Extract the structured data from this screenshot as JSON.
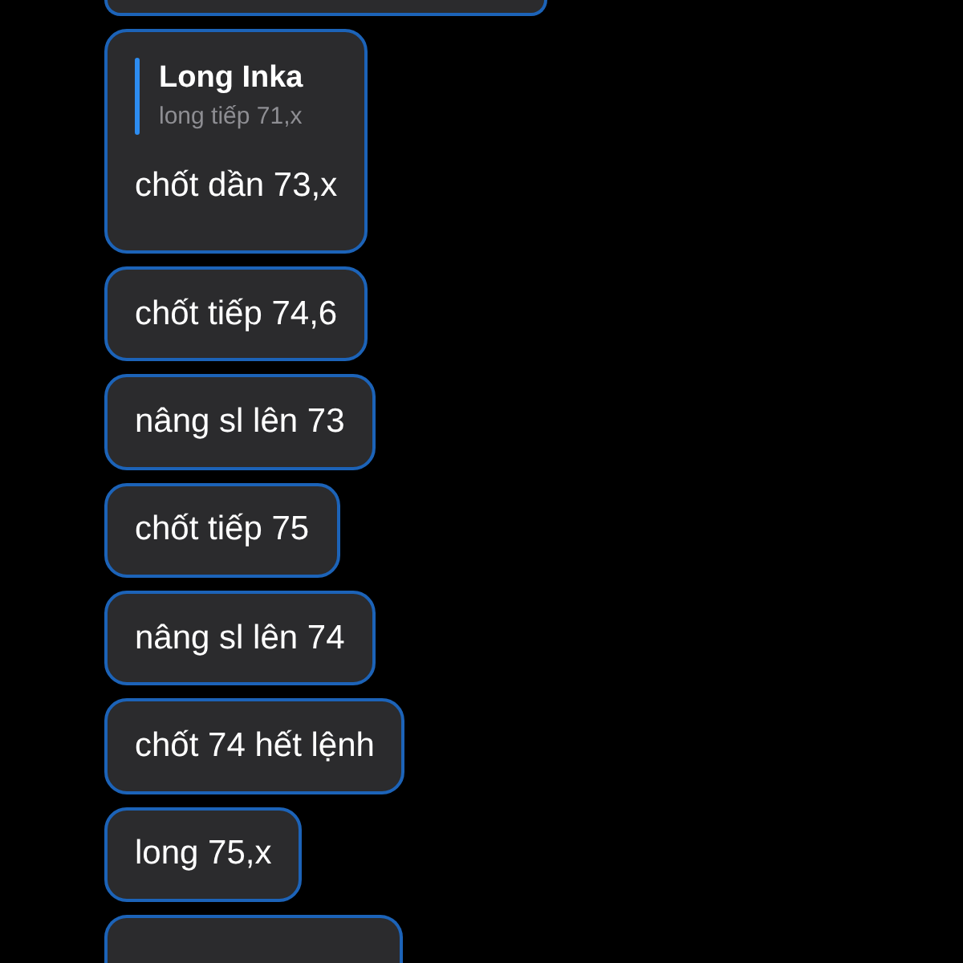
{
  "messages": [
    {
      "kind": "reply",
      "reply_to": {
        "sender": "Long Inka",
        "text": "long tiếp 71,x"
      },
      "text": "chốt dần 73,x"
    },
    {
      "kind": "plain",
      "text": "chốt tiếp 74,6"
    },
    {
      "kind": "plain",
      "text": "nâng sl lên 73"
    },
    {
      "kind": "plain",
      "text": "chốt tiếp 75"
    },
    {
      "kind": "plain",
      "text": "nâng sl lên 74"
    },
    {
      "kind": "plain",
      "text": "chốt 74 hết lệnh"
    },
    {
      "kind": "plain",
      "text": "long 75,x"
    }
  ]
}
